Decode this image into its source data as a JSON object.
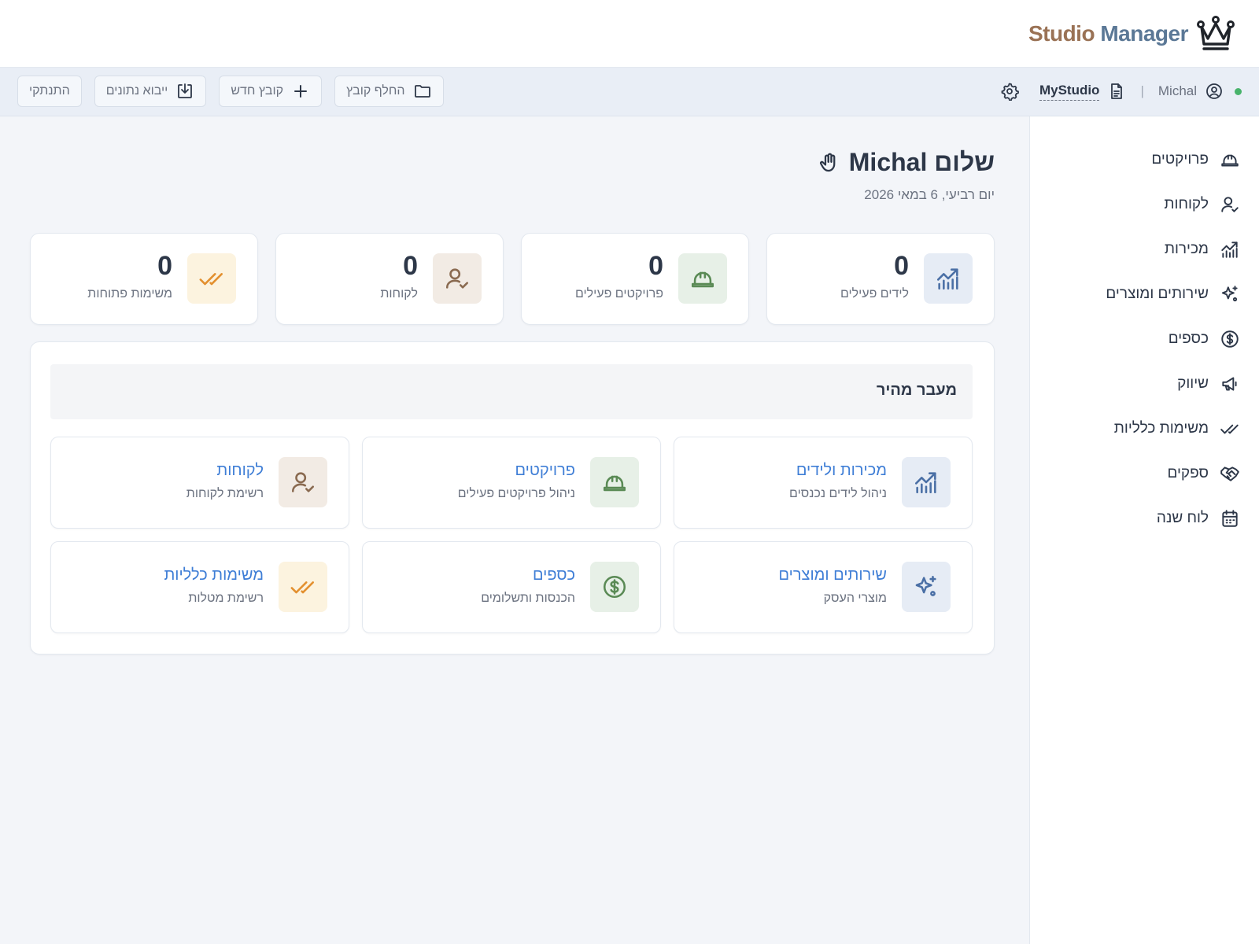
{
  "brand": {
    "studio": "Studio",
    "manager": "Manager"
  },
  "toolbar": {
    "user": "Michal",
    "separator": "|",
    "studio": "MyStudio",
    "switch_file": "החלף קובץ",
    "new_file": "קובץ חדש",
    "import_data": "ייבוא נתונים",
    "logout": "התנתקי"
  },
  "sidebar": {
    "items": [
      {
        "label": "פרויקטים",
        "icon": "helmet-icon"
      },
      {
        "label": "לקוחות",
        "icon": "user-check-icon"
      },
      {
        "label": "מכירות",
        "icon": "chart-icon"
      },
      {
        "label": "שירותים ומוצרים",
        "icon": "sparkle-icon"
      },
      {
        "label": "כספים",
        "icon": "dollar-icon"
      },
      {
        "label": "שיווק",
        "icon": "megaphone-icon"
      },
      {
        "label": "משימות כלליות",
        "icon": "double-check-icon"
      },
      {
        "label": "ספקים",
        "icon": "handshake-icon"
      },
      {
        "label": "לוח שנה",
        "icon": "calendar-icon"
      }
    ]
  },
  "main": {
    "greeting": "שלום Michal",
    "date": "יום רביעי, 6 במאי 2026",
    "stats": [
      {
        "value": "0",
        "label": "לידים פעילים",
        "icon": "chart-icon",
        "color": "#4a6fa5"
      },
      {
        "value": "0",
        "label": "פרויקטים פעילים",
        "icon": "helmet-icon",
        "color": "#5a8a55"
      },
      {
        "value": "0",
        "label": "לקוחות",
        "icon": "user-check-icon",
        "color": "#8a6a50"
      },
      {
        "value": "0",
        "label": "משימות פתוחות",
        "icon": "double-check-icon",
        "color": "#e3902f"
      }
    ],
    "quick": {
      "title": "מעבר מהיר",
      "cards": [
        {
          "title": "מכירות ולידים",
          "subtitle": "ניהול לידים נכנסים",
          "icon": "chart-icon"
        },
        {
          "title": "פרויקטים",
          "subtitle": "ניהול פרויקטים פעילים",
          "icon": "helmet-icon"
        },
        {
          "title": "לקוחות",
          "subtitle": "רשימת לקוחות",
          "icon": "user-check-icon"
        },
        {
          "title": "שירותים ומוצרים",
          "subtitle": "מוצרי העסק",
          "icon": "sparkle-icon"
        },
        {
          "title": "כספים",
          "subtitle": "הכנסות ותשלומים",
          "icon": "dollar-icon"
        },
        {
          "title": "משימות כלליות",
          "subtitle": "רשימת מטלות",
          "icon": "double-check-icon"
        }
      ]
    }
  }
}
